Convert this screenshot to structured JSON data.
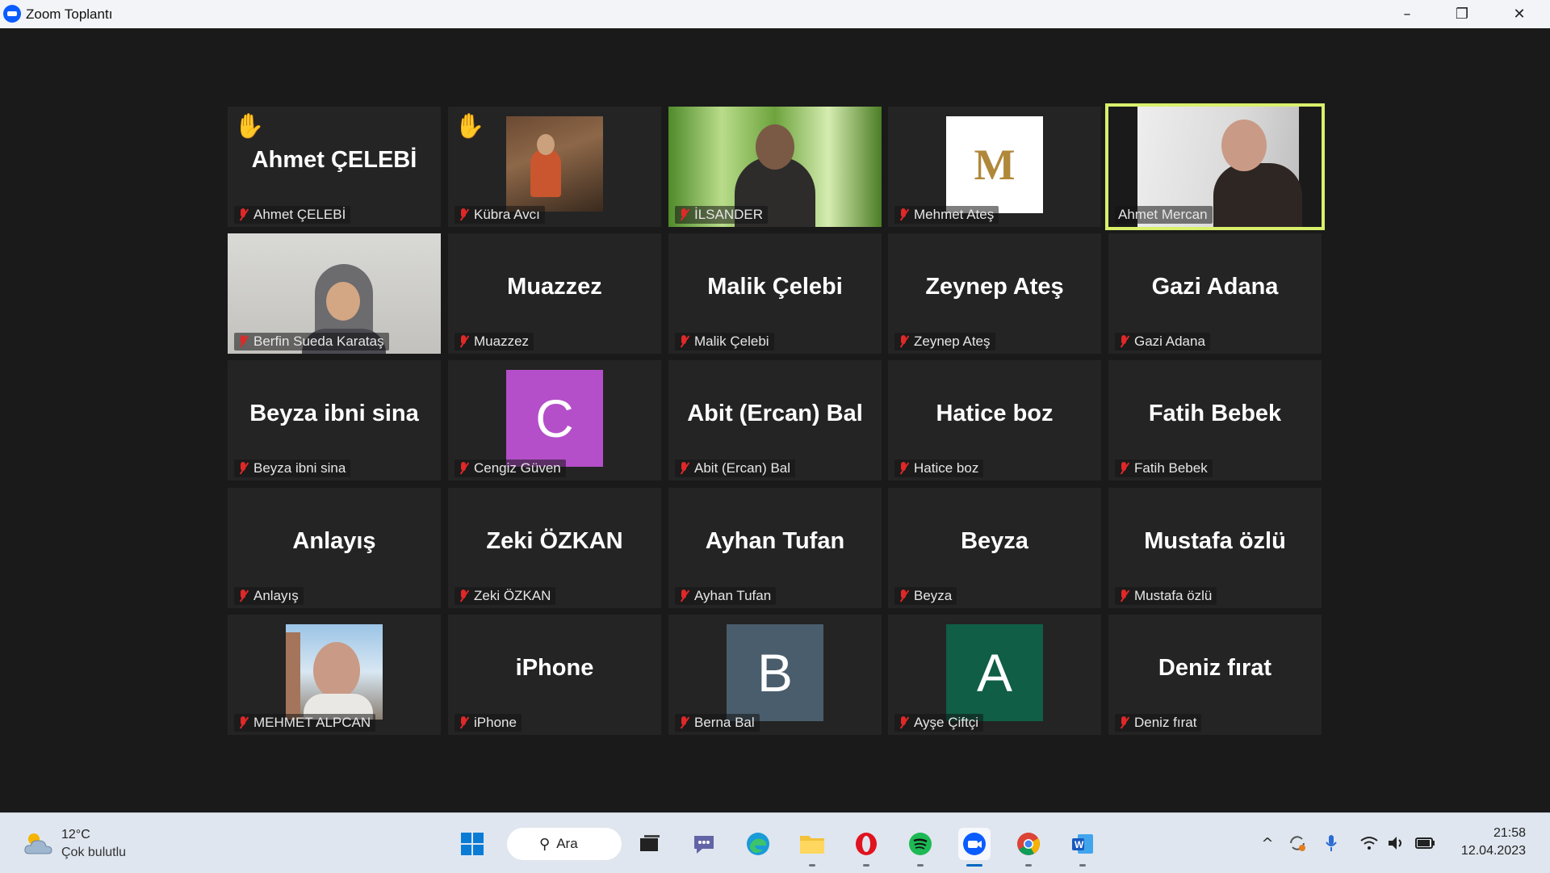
{
  "window": {
    "title": "Zoom Toplantı",
    "minimize_glyph": "–",
    "maximize_glyph": "❐",
    "close_glyph": "✕"
  },
  "participants": [
    {
      "tile_text": "Ahmet ÇELEBİ",
      "label": "Ahmet ÇELEBİ",
      "hand_raised": true,
      "muted": true
    },
    {
      "tile_text": "",
      "label": "Kübra Avcı",
      "hand_raised": true,
      "muted": true,
      "video": "photo"
    },
    {
      "tile_text": "",
      "label": "İLSANDER",
      "hand_raised": false,
      "muted": true,
      "video": "photo"
    },
    {
      "tile_text": "",
      "label": "Mehmet Ateş",
      "hand_raised": false,
      "muted": true,
      "avatar_letter": "M",
      "avatar_color": "#ffffff",
      "avatar_text_color": "#b0883a"
    },
    {
      "tile_text": "",
      "label": "Ahmet Mercan",
      "hand_raised": false,
      "muted": false,
      "video": "photo",
      "active_speaker": true
    },
    {
      "tile_text": "",
      "label": "Berfin Sueda Karataş",
      "hand_raised": false,
      "muted": true,
      "video": "photo"
    },
    {
      "tile_text": "Muazzez",
      "label": "Muazzez",
      "hand_raised": false,
      "muted": true
    },
    {
      "tile_text": "Malik Çelebi",
      "label": "Malik Çelebi",
      "hand_raised": false,
      "muted": true
    },
    {
      "tile_text": "Zeynep Ateş",
      "label": "Zeynep Ateş",
      "hand_raised": false,
      "muted": true
    },
    {
      "tile_text": "Gazi Adana",
      "label": "Gazi Adana",
      "hand_raised": false,
      "muted": true
    },
    {
      "tile_text": "Beyza ibni sina",
      "label": "Beyza ibni sina",
      "hand_raised": false,
      "muted": true
    },
    {
      "tile_text": "",
      "label": "Cengiz Güven",
      "hand_raised": false,
      "muted": true,
      "avatar_letter": "C",
      "avatar_color": "#b44fc9",
      "avatar_text_color": "#ffffff"
    },
    {
      "tile_text": "Abit (Ercan) Bal",
      "label": "Abit (Ercan) Bal",
      "hand_raised": false,
      "muted": true
    },
    {
      "tile_text": "Hatice boz",
      "label": "Hatice boz",
      "hand_raised": false,
      "muted": true
    },
    {
      "tile_text": "Fatih Bebek",
      "label": "Fatih Bebek",
      "hand_raised": false,
      "muted": true
    },
    {
      "tile_text": "Anlayış",
      "label": "Anlayış",
      "hand_raised": false,
      "muted": true
    },
    {
      "tile_text": "Zeki ÖZKAN",
      "label": "Zeki ÖZKAN",
      "hand_raised": false,
      "muted": true
    },
    {
      "tile_text": "Ayhan Tufan",
      "label": "Ayhan Tufan",
      "hand_raised": false,
      "muted": true
    },
    {
      "tile_text": "Beyza",
      "label": "Beyza",
      "hand_raised": false,
      "muted": true
    },
    {
      "tile_text": "Mustafa özlü",
      "label": "Mustafa özlü",
      "hand_raised": false,
      "muted": true
    },
    {
      "tile_text": "",
      "label": "MEHMET ALPCAN",
      "hand_raised": false,
      "muted": true,
      "video": "photo"
    },
    {
      "tile_text": "iPhone",
      "label": "iPhone",
      "hand_raised": false,
      "muted": true
    },
    {
      "tile_text": "",
      "label": "Berna Bal",
      "hand_raised": false,
      "muted": true,
      "avatar_letter": "B",
      "avatar_color": "#4a5d6c",
      "avatar_text_color": "#ffffff"
    },
    {
      "tile_text": "",
      "label": "Ayşe Çiftçi",
      "hand_raised": false,
      "muted": true,
      "avatar_letter": "A",
      "avatar_color": "#0f5e45",
      "avatar_text_color": "#ffffff"
    },
    {
      "tile_text": "Deniz fırat",
      "label": "Deniz fırat",
      "hand_raised": false,
      "muted": true
    }
  ],
  "taskbar": {
    "weather": {
      "temp": "12°C",
      "condition": "Çok bulutlu",
      "icon": "cloud-sun-icon"
    },
    "search_label": "Ara",
    "apps": [
      "windows-start-icon",
      "task-view-icon",
      "teams-chat-icon",
      "edge-icon",
      "file-explorer-icon",
      "opera-icon",
      "spotify-icon",
      "zoom-icon",
      "chrome-icon",
      "word-icon"
    ],
    "tray": {
      "chevron": "^",
      "time": "21:58",
      "date": "12.04.2023"
    }
  }
}
